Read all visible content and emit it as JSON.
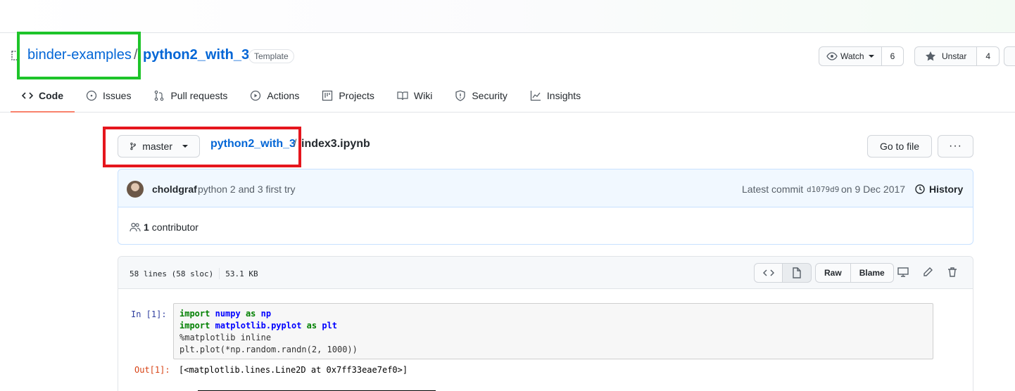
{
  "repo": {
    "owner": "binder-examples",
    "separator": "/",
    "name": "python2_with_3",
    "badge": "Template"
  },
  "actions": {
    "watch_label": "Watch",
    "watch_count": "6",
    "star_label": "Unstar",
    "star_count": "4"
  },
  "tabs": [
    {
      "label": "Code",
      "icon": "code-icon",
      "active": true
    },
    {
      "label": "Issues",
      "icon": "issue-icon"
    },
    {
      "label": "Pull requests",
      "icon": "pull-request-icon"
    },
    {
      "label": "Actions",
      "icon": "play-icon"
    },
    {
      "label": "Projects",
      "icon": "project-icon"
    },
    {
      "label": "Wiki",
      "icon": "book-icon"
    },
    {
      "label": "Security",
      "icon": "shield-icon"
    },
    {
      "label": "Insights",
      "icon": "graph-icon"
    }
  ],
  "file_nav": {
    "branch": "master",
    "crumb_repo": "python2_with_3",
    "crumb_sep": "/",
    "file_name": "index3.ipynb",
    "goto_label": "Go to file",
    "more_label": "···"
  },
  "commit": {
    "author": "choldgraf",
    "message": "python 2 and 3 first try",
    "latest_label": "Latest commit",
    "sha": "d1079d9",
    "date": "on 9 Dec 2017",
    "history_label": "History",
    "contributors_count": "1",
    "contributors_label": "contributor"
  },
  "file": {
    "lines": "58 lines (58 sloc)",
    "size": "53.1 KB",
    "raw_label": "Raw",
    "blame_label": "Blame"
  },
  "notebook": {
    "in_prompt": "In  [1]:",
    "code": {
      "l1_kw": "import",
      "l1_mod": "numpy",
      "l1_as": "as",
      "l1_alias": "np",
      "l2_kw": "import",
      "l2_mod": "matplotlib.pyplot",
      "l2_as": "as",
      "l2_alias": "plt",
      "l3": "%matplotlib inline",
      "l4": "plt.plot(*np.random.randn(2, 1000))"
    },
    "out_prompt": "Out[1]:",
    "output": "[<matplotlib.lines.Line2D at 0x7ff33eae7ef0>]"
  },
  "colors": {
    "link": "#0366d6",
    "active_tab_underline": "#f9826c",
    "highlight_green": "#1ec42a",
    "highlight_red": "#e5161d"
  }
}
